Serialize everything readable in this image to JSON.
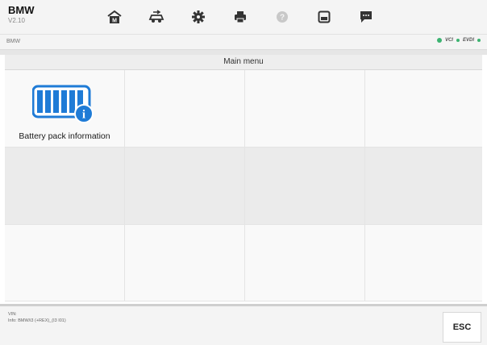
{
  "app": {
    "title": "BMW",
    "version": "V2.10"
  },
  "toolbar": [
    {
      "name": "home-icon",
      "icon": "home",
      "enabled": true
    },
    {
      "name": "vehicle-swap-icon",
      "icon": "vehicle-swap",
      "enabled": true
    },
    {
      "name": "settings-gear-icon",
      "icon": "gear",
      "enabled": true
    },
    {
      "name": "print-icon",
      "icon": "printer",
      "enabled": true
    },
    {
      "name": "help-icon",
      "icon": "help",
      "enabled": false
    },
    {
      "name": "save-icon",
      "icon": "save",
      "enabled": true
    },
    {
      "name": "message-icon",
      "icon": "chat",
      "enabled": true
    }
  ],
  "breadcrumb": "BMW",
  "status": {
    "vci_label": "VCI",
    "evdi_label": "EVDI",
    "active_color": "#3cb371"
  },
  "menu": {
    "header": "Main menu",
    "items": [
      {
        "label": "Battery pack information",
        "icon": "battery-pack-info-icon"
      }
    ]
  },
  "footer": {
    "vin_label": "VIN:",
    "info": "Info: BMW/i3 (+REX)_(I3 I01)",
    "esc_label": "ESC"
  },
  "colors": {
    "accent": "#1f7bd6",
    "toolbar_icon": "#333333",
    "disabled_icon": "#c8c8c8"
  }
}
